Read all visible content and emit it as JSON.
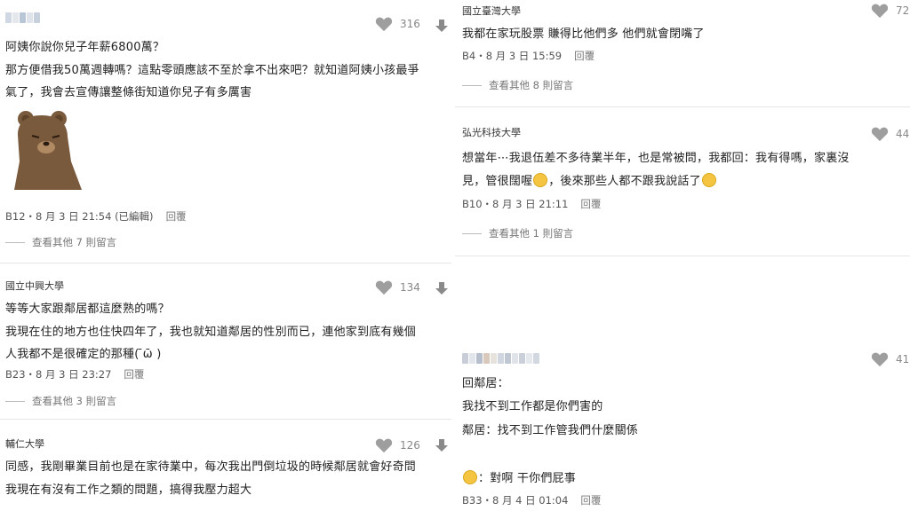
{
  "colors": {
    "accent_gray": "#9e9e9e",
    "separator": "#e6e6e6",
    "text": "#222222",
    "emoji": "#f5c542"
  },
  "icons": {
    "like": "heart-icon",
    "dislike": "arrow-down-icon",
    "sticker": "bear-sticker",
    "emoji": "face-emoji"
  },
  "left": {
    "c1": {
      "likes": "316",
      "lines": [
        "阿姨你說你兒子年薪6800萬？",
        "那方便借我50萬週轉嗎？這點零頭應該不至於拿不出來吧？就知道阿姨小孩最爭",
        "氣了，我會去宣傳讓整條街知道你兒子有多厲害"
      ],
      "floor": "B12・8 月 3 日 21:54 (已編輯)",
      "reply": "回覆",
      "more": "查看其他 7 則留言"
    },
    "c2": {
      "author": "國立中興大學",
      "likes": "134",
      "lines": [
        "等等大家跟鄰居都這麼熟的嗎？",
        "我現在住的地方也住快四年了，我也就知道鄰居的性別而已，連他家到底有幾個",
        "人我都不是很確定的那種(  ̄ω̄ )"
      ],
      "floor": "B23・8 月 3 日 23:27",
      "reply": "回覆",
      "more": "查看其他 3 則留言"
    },
    "c3": {
      "author": "輔仁大學",
      "likes": "126",
      "lines": [
        "同感，我剛畢業目前也是在家待業中，每次我出門倒垃圾的時候鄰居就會好奇問",
        "我現在有沒有工作之類的問題，搞得我壓力超大"
      ]
    }
  },
  "right": {
    "c1": {
      "author": "國立臺灣大學",
      "likes": "72",
      "lines": [
        "我都在家玩股票 賺得比他們多 他們就會閉嘴了"
      ],
      "floor": "B4・8 月 3 日 15:59",
      "reply": "回覆",
      "more": "查看其他 8 則留言"
    },
    "c2": {
      "author": "弘光科技大學",
      "likes": "44",
      "line1": "想當年⋯我退伍差不多待業半年，也是常被問，我都回：我有得嗎，家裏沒",
      "line2a": "見，管很闊喔",
      "line2b": "，後來那些人都不跟我說話了",
      "floor": "B10・8 月 3 日 21:11",
      "reply": "回覆",
      "more": "查看其他 1 則留言"
    },
    "c3": {
      "likes": "41",
      "lines": [
        "回鄰居：",
        "我找不到工作都是你們害的",
        "鄰居：找不到工作管我們什麼關係"
      ],
      "last_line": "：對啊 干你們屁事",
      "floor": "B33・8 月 4 日 01:04",
      "reply": "回覆"
    }
  }
}
